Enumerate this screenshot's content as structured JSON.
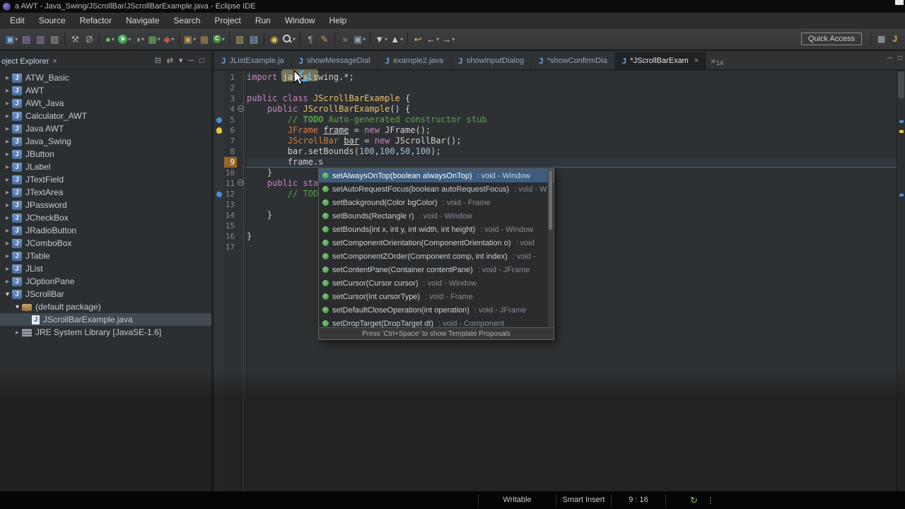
{
  "title_bar": {
    "title": "a AWT - Java_Swing/JScrollBar/JScrollBarExample.java - Eclipse IDE"
  },
  "menu": {
    "items": [
      "Edit",
      "Source",
      "Refactor",
      "Navigate",
      "Search",
      "Project",
      "Run",
      "Window",
      "Help"
    ]
  },
  "toolbar": {
    "quick_access_label": "Quick Access",
    "items": [
      {
        "name": "new-wizard",
        "dd": true
      },
      {
        "name": "save"
      },
      {
        "name": "save-all"
      },
      {
        "name": "print",
        "sep": true
      },
      {
        "name": "build"
      },
      {
        "name": "skip-breakpoints",
        "sep": true
      },
      {
        "name": "debug",
        "dd": true
      },
      {
        "name": "run",
        "dd": true
      },
      {
        "name": "profile",
        "dd": true
      },
      {
        "name": "coverage",
        "dd": true
      },
      {
        "name": "external-tools",
        "dd": true,
        "sep": true
      },
      {
        "name": "new-java-project",
        "dd": true
      },
      {
        "name": "new-package"
      },
      {
        "name": "new-class",
        "dd": true,
        "sep": true
      },
      {
        "name": "jar-export"
      },
      {
        "name": "javadoc",
        "sep": true
      },
      {
        "name": "open-type"
      },
      {
        "name": "search",
        "dd": true,
        "sep": true
      },
      {
        "name": "show-whitespace"
      },
      {
        "name": "format",
        "sep": true
      },
      {
        "name": "toggle-breadcrumb"
      },
      {
        "name": "annotations",
        "dd": true,
        "sep": true
      },
      {
        "name": "next-annotation",
        "dd": true
      },
      {
        "name": "prev-annotation",
        "dd": true,
        "sep": true
      },
      {
        "name": "last-edit-location"
      },
      {
        "name": "back",
        "dd": true
      },
      {
        "name": "forward",
        "dd": true
      }
    ],
    "right_items": [
      {
        "name": "open-perspective"
      },
      {
        "name": "java-perspective"
      }
    ]
  },
  "project_explorer": {
    "title": "oject Explorer",
    "header_icons": [
      "collapse-all",
      "link-with-editor",
      "view-menu",
      "minimize",
      "maximize"
    ],
    "items": [
      {
        "label": "ATW_Basic",
        "icon": "java-project",
        "arrow": "collapsed",
        "level": 0
      },
      {
        "label": "AWT",
        "icon": "java-project",
        "arrow": "collapsed",
        "level": 0
      },
      {
        "label": "AWt_Java",
        "icon": "java-project",
        "arrow": "collapsed",
        "level": 0
      },
      {
        "label": "Calculator_AWT",
        "icon": "java-project",
        "arrow": "collapsed",
        "level": 0
      },
      {
        "label": "Java AWT",
        "icon": "java-project",
        "arrow": "collapsed",
        "level": 0
      },
      {
        "label": "Java_Swing",
        "icon": "java-project",
        "arrow": "collapsed",
        "level": 0
      },
      {
        "label": "JButton",
        "icon": "java-project",
        "arrow": "collapsed",
        "level": 0
      },
      {
        "label": "JLabel",
        "icon": "java-project",
        "arrow": "collapsed",
        "level": 0
      },
      {
        "label": "JTextField",
        "icon": "java-project",
        "arrow": "collapsed",
        "level": 0
      },
      {
        "label": "JTextArea",
        "icon": "java-project",
        "arrow": "collapsed",
        "level": 0
      },
      {
        "label": "JPassword",
        "icon": "java-project",
        "arrow": "collapsed",
        "level": 0
      },
      {
        "label": "JCheckBox",
        "icon": "java-project",
        "arrow": "collapsed",
        "level": 0
      },
      {
        "label": "JRadioButton",
        "icon": "java-project",
        "arrow": "collapsed",
        "level": 0
      },
      {
        "label": "JComboBox",
        "icon": "java-project",
        "arrow": "collapsed",
        "level": 0
      },
      {
        "label": "JTable",
        "icon": "java-project",
        "arrow": "collapsed",
        "level": 0
      },
      {
        "label": "JList",
        "icon": "java-project",
        "arrow": "collapsed",
        "level": 0
      },
      {
        "label": "JOptionPane",
        "icon": "java-project",
        "arrow": "collapsed",
        "level": 0
      },
      {
        "label": "JScrollBar",
        "icon": "java-project",
        "arrow": "expanded",
        "level": 0
      },
      {
        "label": "(default package)",
        "icon": "package",
        "arrow": "expanded",
        "level": 1
      },
      {
        "label": "JScrollBarExample.java",
        "icon": "java-file",
        "arrow": "none",
        "level": 2,
        "selected": true
      },
      {
        "label": "JRE System Library [JavaSE-1.6]",
        "icon": "library",
        "arrow": "collapsed",
        "level": 1
      }
    ]
  },
  "tabs": {
    "items": [
      {
        "label": "JListExample.ja",
        "active": false
      },
      {
        "label": "showMessageDial",
        "active": false
      },
      {
        "label": "example2.java",
        "active": false
      },
      {
        "label": "showInputDialog",
        "active": false
      },
      {
        "label": "*showConfirmDia",
        "active": false
      },
      {
        "label": "*JScrollBarExam",
        "active": true
      }
    ],
    "overflow_count": "14",
    "window_buttons": [
      "minimize",
      "maximize"
    ]
  },
  "editor": {
    "lines": [
      {
        "n": 1,
        "segs": [
          [
            "kw",
            "import"
          ],
          [
            "pl",
            " javax.swing.*;"
          ]
        ]
      },
      {
        "n": 2,
        "segs": []
      },
      {
        "n": 3,
        "segs": [
          [
            "kw",
            "public class"
          ],
          [
            "pl",
            " "
          ],
          [
            "cd",
            "JScrollBarExample"
          ],
          [
            "pl",
            " {"
          ]
        ]
      },
      {
        "n": 4,
        "segs": [
          [
            "pl",
            "    "
          ],
          [
            "kw",
            "public"
          ],
          [
            "pl",
            " "
          ],
          [
            "cd",
            "JScrollBarExample"
          ],
          [
            "pl",
            "() {"
          ]
        ],
        "fold": true
      },
      {
        "n": 5,
        "segs": [
          [
            "cm",
            "        // "
          ],
          [
            "td",
            "TODO"
          ],
          [
            "cm",
            " Auto-generated constructor stub"
          ]
        ],
        "marker": "task"
      },
      {
        "n": 6,
        "segs": [
          [
            "pl",
            "        "
          ],
          [
            "ty",
            "JFrame"
          ],
          [
            "pl",
            " "
          ],
          [
            "vr",
            "frame"
          ],
          [
            "pl",
            " = "
          ],
          [
            "kw",
            "new"
          ],
          [
            "pl",
            " JFrame();"
          ]
        ],
        "marker": "bulb"
      },
      {
        "n": 7,
        "segs": [
          [
            "pl",
            "        "
          ],
          [
            "ty",
            "JScrollBar"
          ],
          [
            "pl",
            " "
          ],
          [
            "vr",
            "bar"
          ],
          [
            "pl",
            " = "
          ],
          [
            "kw",
            "new"
          ],
          [
            "pl",
            " JScrollBar();"
          ]
        ]
      },
      {
        "n": 8,
        "segs": [
          [
            "pl",
            "        bar.setBounds("
          ],
          [
            "nm",
            "100"
          ],
          [
            "pl",
            ","
          ],
          [
            "nm",
            "100"
          ],
          [
            "pl",
            ","
          ],
          [
            "nm",
            "50"
          ],
          [
            "pl",
            ","
          ],
          [
            "nm",
            "100"
          ],
          [
            "pl",
            ");"
          ]
        ]
      },
      {
        "n": 9,
        "segs": [
          [
            "pl",
            "        frame.s"
          ]
        ],
        "current": true
      },
      {
        "n": 10,
        "segs": [
          [
            "pl",
            "    }"
          ]
        ]
      },
      {
        "n": 11,
        "segs": [
          [
            "pl",
            "    "
          ],
          [
            "kw",
            "public sta"
          ]
        ],
        "fold": true
      },
      {
        "n": 12,
        "segs": [
          [
            "cm",
            "        // TOD"
          ]
        ],
        "marker": "task"
      },
      {
        "n": 13,
        "segs": []
      },
      {
        "n": 14,
        "segs": [
          [
            "pl",
            "    }"
          ]
        ]
      },
      {
        "n": 15,
        "segs": []
      },
      {
        "n": 16,
        "segs": [
          [
            "pl",
            "}"
          ]
        ]
      },
      {
        "n": 17,
        "segs": []
      }
    ]
  },
  "popup": {
    "selected_index": 0,
    "items": [
      {
        "label": "setAlwaysOnTop(boolean alwaysOnTop)",
        "detail": ": void - Window"
      },
      {
        "label": "setAutoRequestFocus(boolean autoRequestFocus)",
        "detail": ": void - W"
      },
      {
        "label": "setBackground(Color bgColor)",
        "detail": ": void - Frame"
      },
      {
        "label": "setBounds(Rectangle r)",
        "detail": ": void - Window"
      },
      {
        "label": "setBounds(int x, int y, int width, int height)",
        "detail": ": void - Window"
      },
      {
        "label": "setComponentOrientation(ComponentOrientation o)",
        "detail": ": void"
      },
      {
        "label": "setComponentZOrder(Component comp, int index)",
        "detail": ": void -"
      },
      {
        "label": "setContentPane(Container contentPane)",
        "detail": ": void - JFrame"
      },
      {
        "label": "setCursor(Cursor cursor)",
        "detail": ": void - Window"
      },
      {
        "label": "setCursor(int cursorType)",
        "detail": ": void - Frame"
      },
      {
        "label": "setDefaultCloseOperation(int operation)",
        "detail": ": void - JFrame"
      },
      {
        "label": "setDropTarget(DropTarget dt)",
        "detail": ": void - Component"
      }
    ],
    "footer": "Press 'Ctrl+Space' to show Template Proposals"
  },
  "status_bar": {
    "writable": "Writable",
    "insert_mode": "Smart Insert",
    "position": "9 : 16",
    "icons": [
      "refresh",
      "overflow-menu"
    ]
  }
}
